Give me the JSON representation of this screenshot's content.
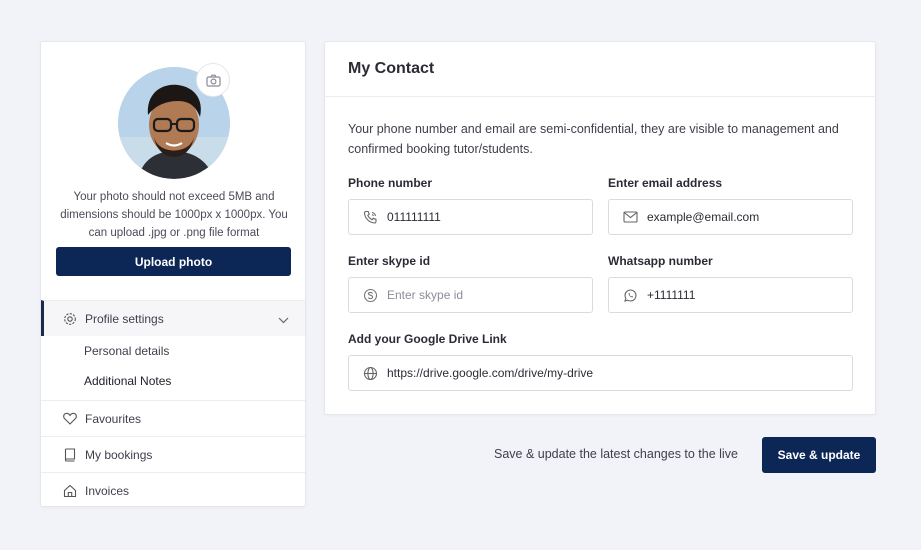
{
  "profile": {
    "photo_note": "Your photo should not exceed 5MB and dimensions should be 1000px x 1000px. You can upload .jpg or .png file format",
    "upload_label": "Upload photo"
  },
  "nav": {
    "profile_settings": "Profile settings",
    "sub_items": [
      "Personal details",
      "Additional Notes"
    ],
    "favourites": "Favourites",
    "bookings": "My bookings",
    "invoices": "Invoices"
  },
  "contact": {
    "title": "My Contact",
    "description": "Your phone number and email are semi-confidential, they are visible to management and confirmed booking tutor/students.",
    "phone_label": "Phone number",
    "phone_value": "011111111",
    "email_label": "Enter email address",
    "email_value": "example@email.com",
    "skype_label": "Enter skype id",
    "skype_placeholder": "Enter skype id",
    "skype_value": "",
    "whatsapp_label": "Whatsapp number",
    "whatsapp_value": "+1111111",
    "drive_label": "Add your Google Drive Link",
    "drive_value": "https://drive.google.com/drive/my-drive"
  },
  "footer": {
    "save_note": "Save & update the latest changes to the live",
    "save_label": "Save & update"
  },
  "colors": {
    "primary": "#0c2756",
    "background": "#f2f3f8",
    "border": "#d9dae2"
  },
  "icons": [
    "camera-icon",
    "gear-icon",
    "chevron-down-icon",
    "heart-icon",
    "book-icon",
    "home-icon",
    "phone-icon",
    "mail-icon",
    "skype-icon",
    "whatsapp-icon",
    "globe-icon"
  ]
}
